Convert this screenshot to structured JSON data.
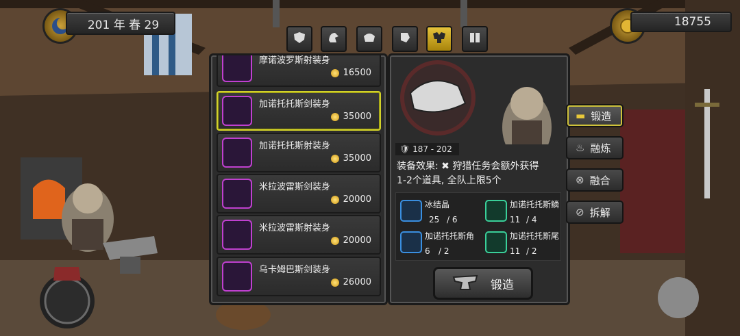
{
  "hud": {
    "date": "201 年 春 29",
    "gold": "18755"
  },
  "category_tabs": [
    {
      "icon": "shield-icon"
    },
    {
      "icon": "helmet-icon"
    },
    {
      "icon": "mask-icon"
    },
    {
      "icon": "gauntlet-icon"
    },
    {
      "icon": "armor-icon",
      "active": true
    },
    {
      "icon": "boots-icon"
    }
  ],
  "items": [
    {
      "name": "摩诺波罗斯射装身",
      "price": "16500"
    },
    {
      "name": "加诺托托斯剑装身",
      "price": "35000",
      "selected": true
    },
    {
      "name": "加诺托托斯射装身",
      "price": "35000"
    },
    {
      "name": "米拉波雷斯剑装身",
      "price": "20000"
    },
    {
      "name": "米拉波雷斯射装身",
      "price": "20000"
    },
    {
      "name": "乌卡姆巴斯剑装身",
      "price": "26000"
    }
  ],
  "detail": {
    "defense": "187 - 202",
    "effect_line1": "装备效果: ✖ 狩猎任务会额外获得",
    "effect_line2": "1-2个道具, 全队上限5个",
    "materials": [
      {
        "name": "冰结晶",
        "count": "25",
        "need": "/ 6",
        "color": "#6fc8ff"
      },
      {
        "name": "加诺托托斯鳞",
        "count": "11",
        "need": "/ 4",
        "color": "#3ad09a"
      },
      {
        "name": "加诺托托斯角",
        "count": "6",
        "need": "/ 2",
        "color": "#3a8fe0"
      },
      {
        "name": "加诺托托斯尾",
        "count": "11",
        "need": "/ 2",
        "color": "#3ad09a"
      }
    ],
    "forge_label": "锻造"
  },
  "side_menu": [
    {
      "label": "锻造",
      "icon": "anvil-icon",
      "active": true
    },
    {
      "label": "融炼",
      "icon": "furnace-icon"
    },
    {
      "label": "融合",
      "icon": "fusion-icon"
    },
    {
      "label": "拆解",
      "icon": "disassemble-icon"
    }
  ]
}
